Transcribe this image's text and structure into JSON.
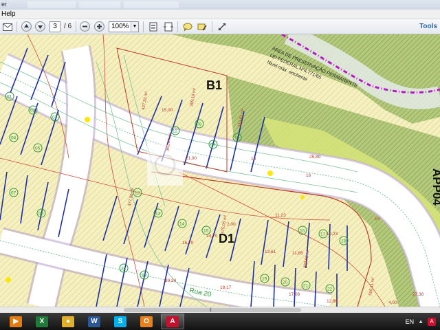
{
  "window": {
    "top_fragment": "er",
    "menu_help": "Help"
  },
  "toolbar": {
    "page_current": "3",
    "page_total": "/ 6",
    "zoom": "100%",
    "tools_label": "Tools"
  },
  "map": {
    "block_labels": [
      "B1",
      "D1"
    ],
    "side_label": "APP04",
    "street_label": "Rua 20",
    "preserve_text_1": "ÁREA DE PRESERVAÇÃO PERMANENTE",
    "preserve_text_2": "LEI FEDERAL Nº4.771/65",
    "preserve_text_3": "Nivel máx. enchente",
    "dimension_labels": [
      "16",
      "18",
      "14",
      "15,00",
      "16,70",
      "14,70",
      "18,17",
      "12,89",
      "17,06",
      "10,23",
      "11,23",
      "11,85",
      "13,61",
      "2,00",
      "4,00",
      "27,38",
      "25,89",
      "21,90",
      "20,34"
    ],
    "lot_numbers": [
      "01",
      "02",
      "03",
      "04",
      "05",
      "06",
      "07",
      "08",
      "09",
      "10",
      "11",
      "12",
      "13",
      "14",
      "15",
      "16",
      "17",
      "18",
      "19",
      "20",
      "21",
      "22",
      "23",
      "24"
    ],
    "area_labels": [
      "427,33 m²",
      "399,19 m²",
      "315,81 m²",
      "352,47 m²",
      "477,90 m²",
      "475,05 m²",
      "556,11 m²",
      "483,69 m²"
    ]
  },
  "taskbar": {
    "lang": "EN",
    "apps": [
      {
        "name": "media-player",
        "color": "#e37b12",
        "glyph": "▶"
      },
      {
        "name": "excel",
        "color": "#1f7a3a",
        "glyph": "X"
      },
      {
        "name": "chrome",
        "color": "#e0b02b",
        "glyph": "●"
      },
      {
        "name": "word",
        "color": "#2b5797",
        "glyph": "W"
      },
      {
        "name": "skype",
        "color": "#00aff0",
        "glyph": "S"
      },
      {
        "name": "outlook",
        "color": "#e8801d",
        "glyph": "O"
      },
      {
        "name": "acrobat",
        "color": "#c8102e",
        "glyph": "A"
      }
    ]
  },
  "colors": {
    "lot_fill": "#f4f0c2",
    "preserve_fill": "#a5bd6a",
    "road_line": "#b59cc9",
    "lot_line": "#1b2ea8",
    "dimension_text": "#c0392b",
    "contour_line": "#d24a3a",
    "lot_number": "#2f9a3a"
  }
}
